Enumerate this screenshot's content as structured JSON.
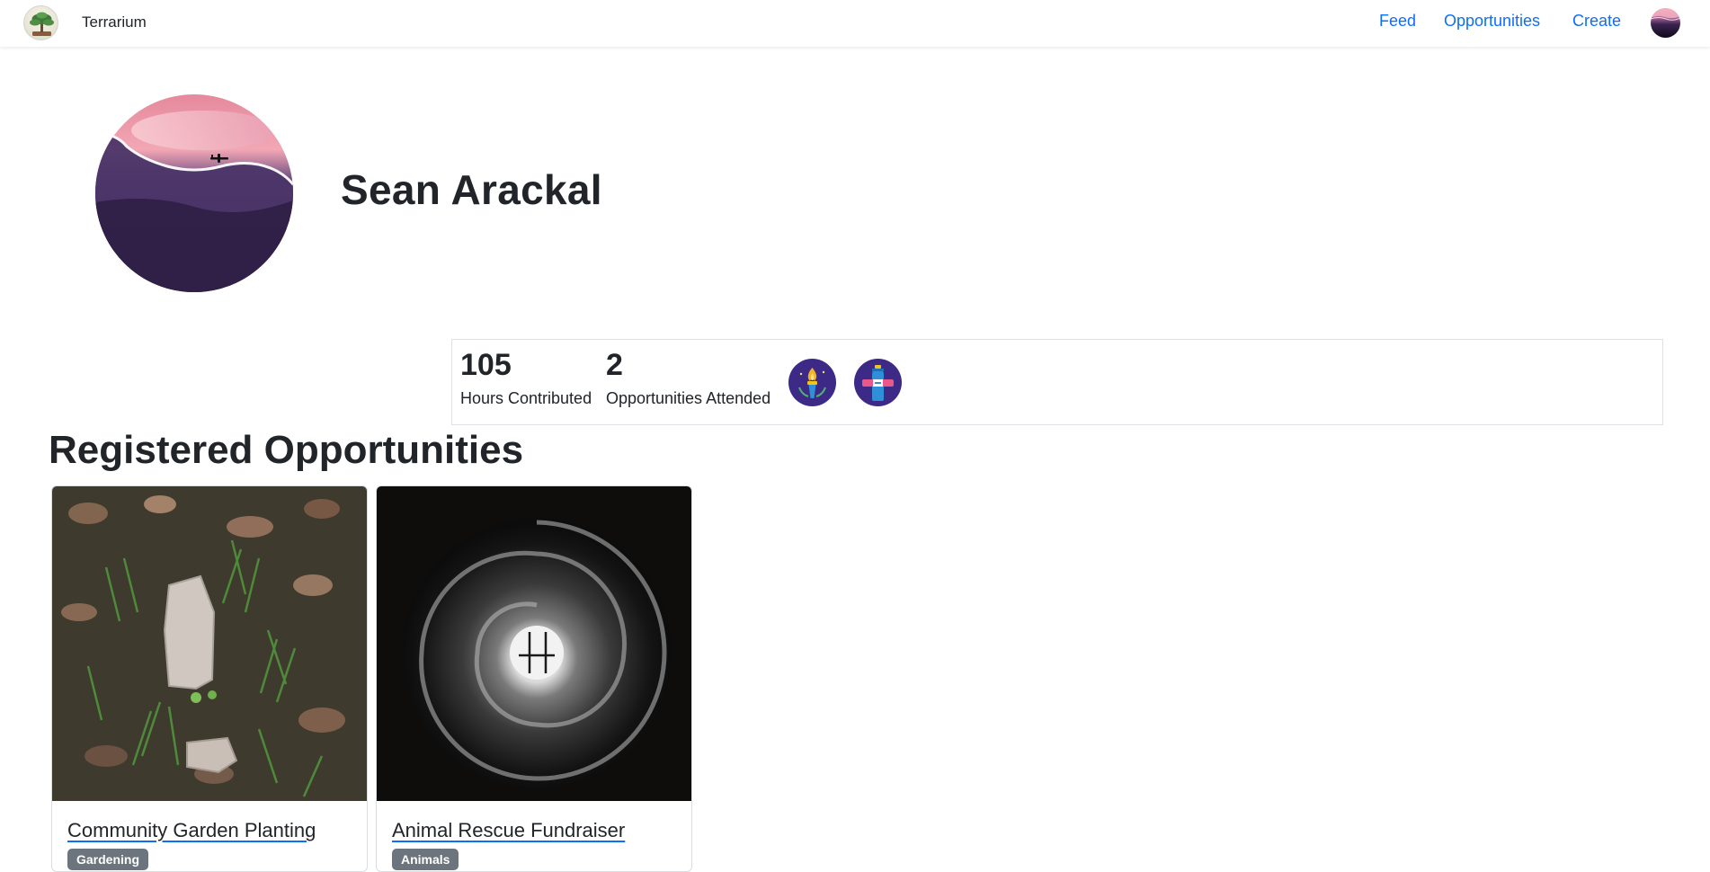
{
  "navbar": {
    "brand_name": "Terrarium",
    "links": {
      "feed": "Feed",
      "opportunities": "Opportunities",
      "create": "Create"
    }
  },
  "profile": {
    "name": "Sean Arackal"
  },
  "stats": {
    "hours": {
      "value": "105",
      "label": "Hours Contributed"
    },
    "attended": {
      "value": "2",
      "label": "Opportunities Attended"
    },
    "badges": [
      "torch-badge-icon",
      "water-bottle-badge-icon"
    ]
  },
  "registered": {
    "title": "Registered Opportunities",
    "cards": [
      {
        "title": "Community Garden Planting",
        "tag": "Gardening"
      },
      {
        "title": "Animal Rescue Fundraiser",
        "tag": "Animals"
      }
    ]
  },
  "colors": {
    "link": "#0d6efd",
    "badge_bg": "#3d2a86",
    "tag_bg": "#6c757d"
  }
}
